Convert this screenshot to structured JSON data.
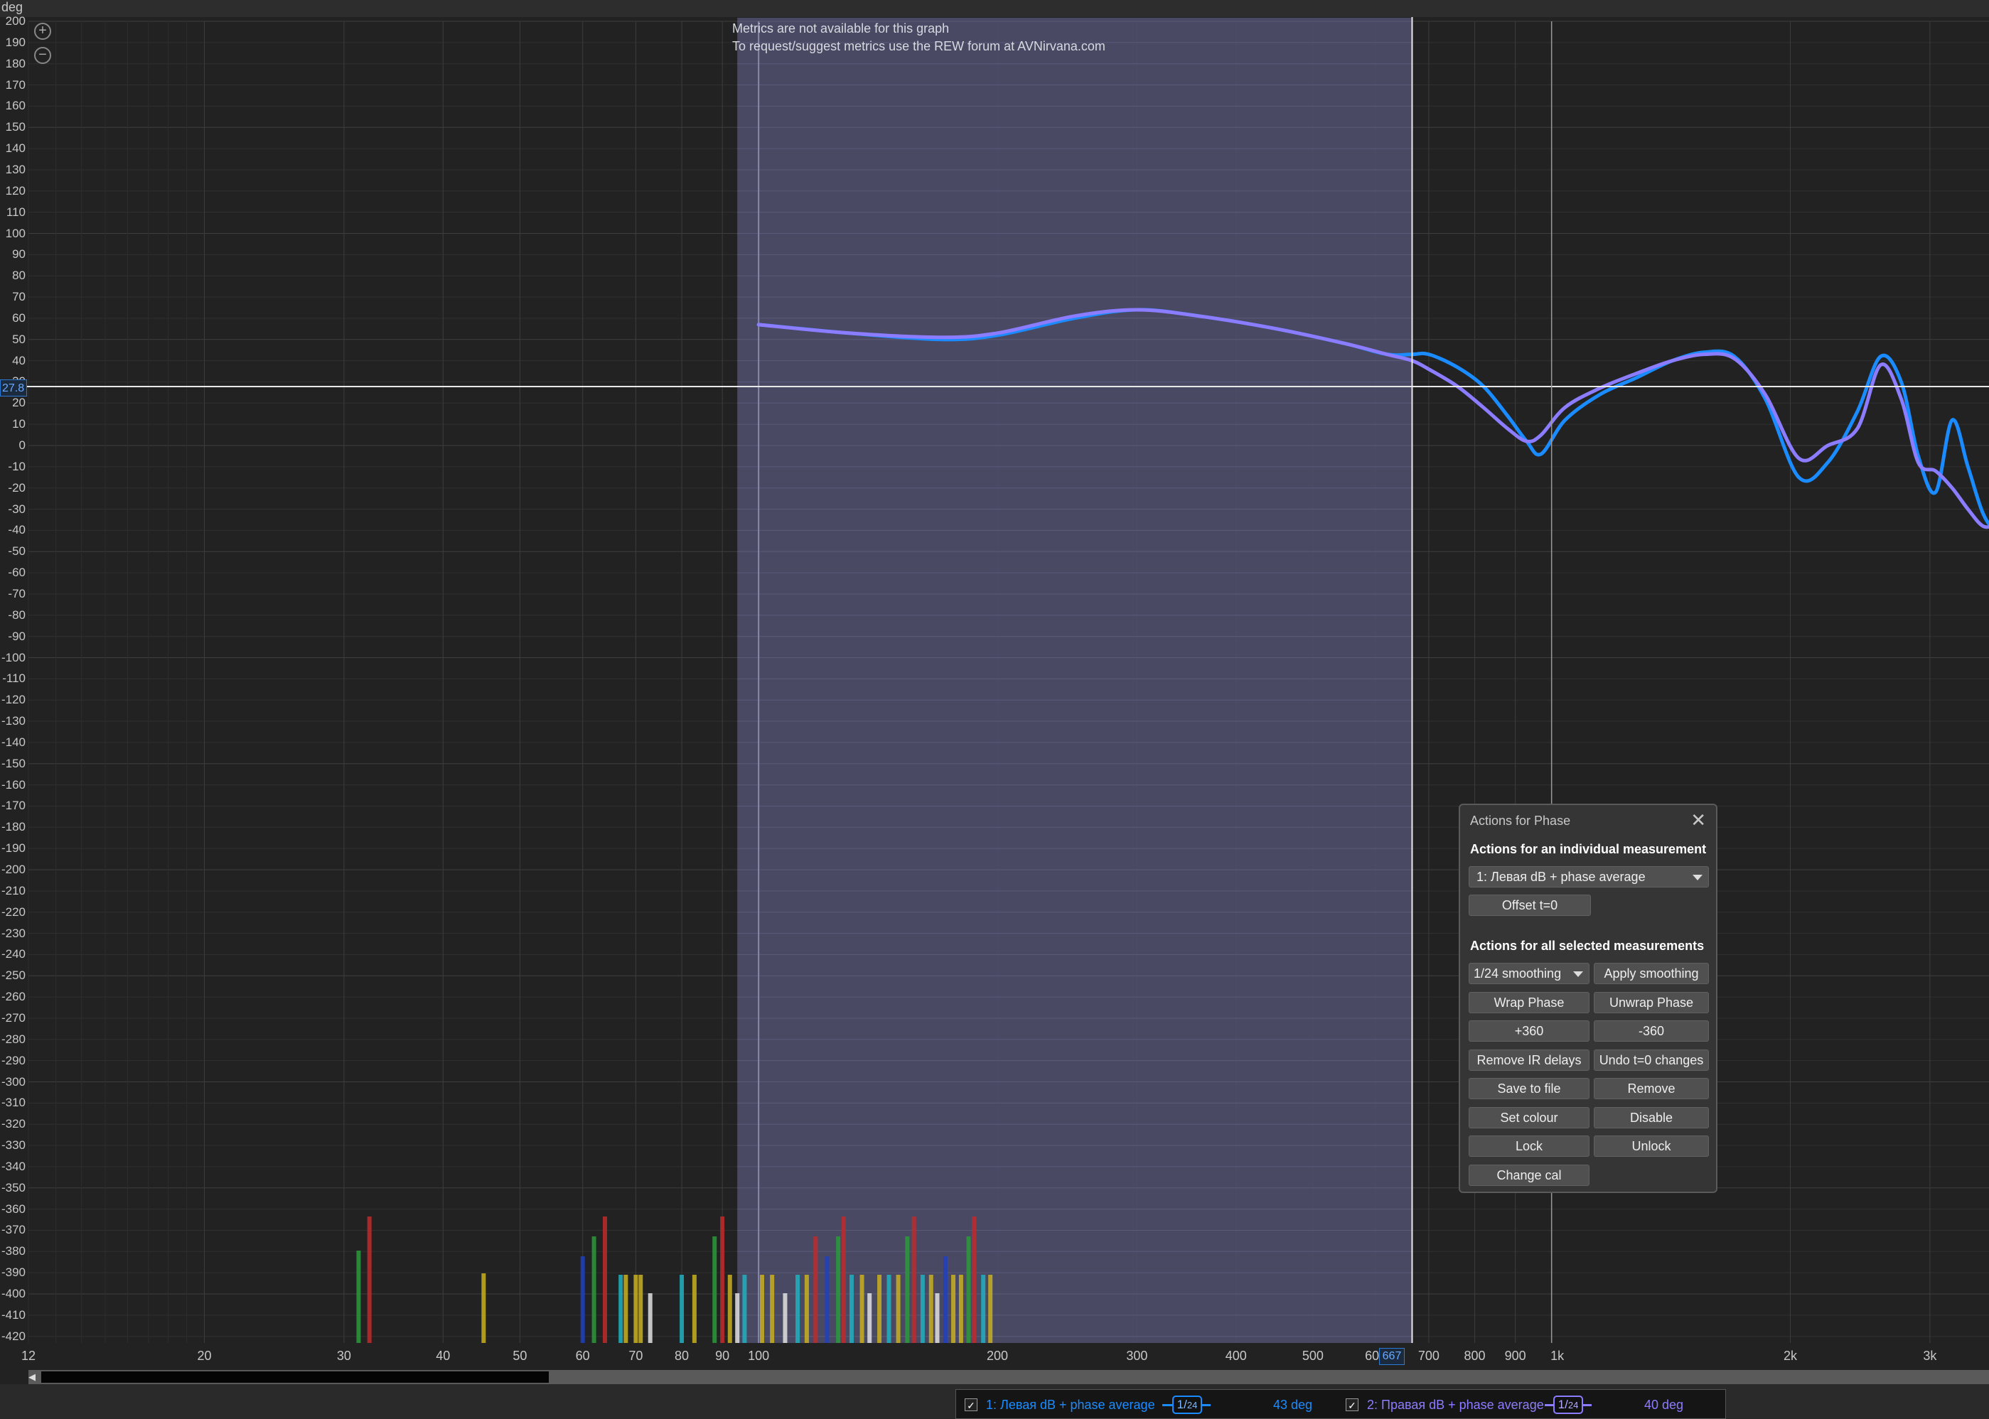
{
  "graph": {
    "unit_label": "deg",
    "y_ticks": [
      "200",
      "190",
      "180",
      "170",
      "160",
      "150",
      "140",
      "130",
      "120",
      "110",
      "100",
      "90",
      "80",
      "70",
      "60",
      "50",
      "40",
      "30",
      "20",
      "10",
      "0",
      "-10",
      "-20",
      "-30",
      "-40",
      "-50",
      "-60",
      "-70",
      "-80",
      "-90",
      "-100",
      "-110",
      "-120",
      "-130",
      "-140",
      "-150",
      "-160",
      "-170",
      "-180",
      "-190",
      "-200",
      "-210",
      "-220",
      "-230",
      "-240",
      "-250",
      "-260",
      "-270",
      "-280",
      "-290",
      "-300",
      "-310",
      "-320",
      "-330",
      "-340",
      "-350",
      "-360",
      "-370",
      "-380",
      "-390",
      "-400",
      "-410",
      "-420"
    ],
    "x_ticks": [
      "12",
      "20",
      "30",
      "40",
      "50",
      "60",
      "70",
      "80",
      "90",
      "100",
      "200",
      "300",
      "400",
      "500",
      "600",
      "700",
      "800",
      "900",
      "1k",
      "2k",
      "3k"
    ],
    "cursor_y_label": "27.8",
    "cursor_x_label": "667",
    "metrics_line1": "Metrics are not available for this graph",
    "metrics_line2": "To request/suggest metrics use the REW forum at AVNirvana.com",
    "colors": {
      "background": "#222222",
      "selection": "#4d4d6a",
      "series1": "#1a8cff",
      "series2": "#8c7cff"
    }
  },
  "chart_data": {
    "type": "line",
    "xscale": "log",
    "xlim": [
      12,
      3900
    ],
    "ylim": [
      -425,
      200
    ],
    "xlabel": "",
    "ylabel": "deg",
    "selection_range": [
      94,
      667
    ],
    "cursor": {
      "x": 667,
      "y": 27.8
    },
    "series": [
      {
        "name": "1: Левая dB + phase average",
        "color": "#1a8cff",
        "x": [
          100,
          130,
          170,
          200,
          250,
          300,
          360,
          450,
          550,
          620,
          667,
          700,
          760,
          820,
          880,
          930,
          970,
          1040,
          1150,
          1280,
          1420,
          1560,
          1700,
          1860,
          2050,
          2230,
          2430,
          2600,
          2760,
          2900,
          3050,
          3200,
          3350,
          3500,
          3650,
          3800
        ],
        "y": [
          57,
          53,
          50,
          52,
          60,
          64,
          61,
          55,
          48,
          43,
          43,
          43,
          37,
          28,
          14,
          2,
          -4,
          12,
          24,
          32,
          40,
          44,
          42,
          22,
          -15,
          -8,
          16,
          42,
          30,
          -5,
          -22,
          12,
          -10,
          -32,
          -42,
          -50
        ]
      },
      {
        "name": "2: Правая dB + phase average",
        "color": "#8c7cff",
        "x": [
          100,
          130,
          170,
          200,
          250,
          300,
          360,
          450,
          550,
          620,
          667,
          700,
          760,
          820,
          880,
          930,
          970,
          1040,
          1150,
          1280,
          1420,
          1560,
          1700,
          1860,
          2050,
          2230,
          2430,
          2600,
          2760,
          2900,
          3050,
          3200,
          3350,
          3500,
          3650,
          3800
        ],
        "y": [
          57,
          53,
          51,
          53,
          61,
          64,
          61,
          55,
          48,
          43,
          40,
          36,
          28,
          18,
          8,
          2,
          5,
          18,
          27,
          34,
          40,
          43,
          41,
          24,
          -6,
          0,
          8,
          38,
          22,
          -8,
          -12,
          -20,
          -30,
          -38,
          -38,
          -42
        ]
      }
    ]
  },
  "zoom_in_icon": "zoom-in-icon",
  "zoom_out_icon": "zoom-out-icon",
  "dialog": {
    "title": "Actions for Phase",
    "section1": "Actions for an individual measurement",
    "measurement_selected": "1: Левая dB + phase average",
    "offset_button": "Offset t=0",
    "section2": "Actions for all selected measurements",
    "smoothing_selected": "1/24 smoothing",
    "apply_smoothing": "Apply smoothing",
    "wrap_phase": "Wrap Phase",
    "unwrap_phase": "Unwrap Phase",
    "plus360": "+360",
    "minus360": "-360",
    "remove_ir_delays": "Remove IR delays",
    "undo_t0": "Undo t=0 changes",
    "save_to_file": "Save to file",
    "remove": "Remove",
    "set_colour": "Set colour",
    "disable": "Disable",
    "lock": "Lock",
    "unlock": "Unlock",
    "change_cal": "Change cal"
  },
  "legend": {
    "item1": {
      "label": "1: Левая dB + phase average",
      "smoothing_num": "1",
      "smoothing_den": "24",
      "value": "43 deg",
      "checked": "✓",
      "color": "#1a8cff"
    },
    "item2": {
      "label": "2: Правая dB + phase average",
      "smoothing_num": "1",
      "smoothing_den": "24",
      "value": "40 deg",
      "checked": "✓",
      "color": "#8c7cff"
    }
  }
}
